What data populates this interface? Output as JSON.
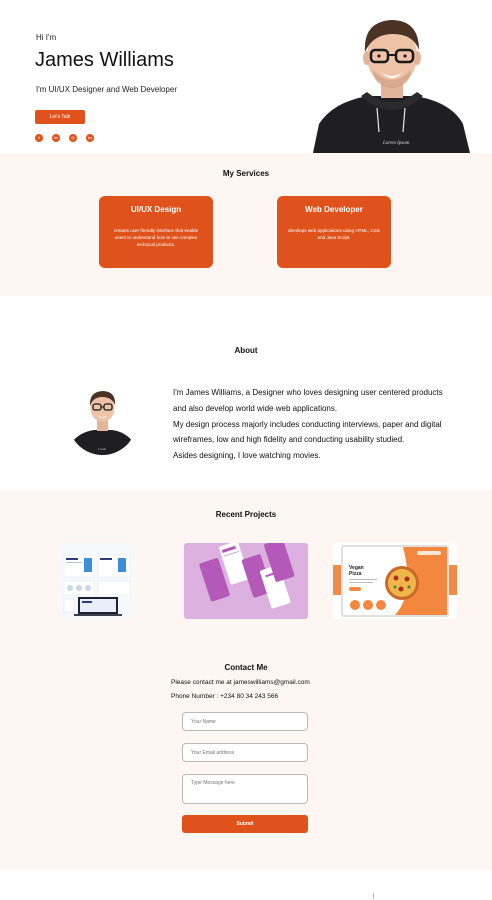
{
  "hero": {
    "greeting": "Hi I'm",
    "name": "James Williams",
    "role": "I'm UI/UX Designer and Web Developer",
    "cta_label": "Let's Talk",
    "socials": [
      {
        "icon": "twitter-icon",
        "glyph": "t"
      },
      {
        "icon": "linkedin-icon",
        "glyph": "in"
      },
      {
        "icon": "instagram-icon",
        "glyph": "◎"
      },
      {
        "icon": "linkedin-icon",
        "glyph": "in"
      }
    ]
  },
  "services": {
    "title": "My Services",
    "cards": [
      {
        "title": "UI/UX Design",
        "desc": "creates user friendly interface that enable users to understand how to use complex technical products."
      },
      {
        "title": "Web Developer",
        "desc": "develops web applications using HTML, CSS and Java Script."
      }
    ]
  },
  "about": {
    "title": "About",
    "lines": [
      "I'm James Williams, a Designer who loves designing user centered products",
      "and also develop world wide web applications.",
      "My design process majorly includes conducting interviews, paper and digital",
      "wireframes, low and high fidelity and conducting usability studied.",
      "Asides designing, I love watching movies."
    ]
  },
  "projects": {
    "title": "Recent Projects",
    "pizza": {
      "title_line1": "Vegan",
      "title_line2": "Pizza"
    }
  },
  "contact": {
    "title": "Contact Me",
    "email_line": "Please contact me at jameswilliams@gmail.com",
    "phone_line": "Phone Number : +234 80 34 243 566",
    "name_placeholder": "Your Name",
    "email_placeholder": "Your Email address",
    "message_placeholder": "Type Message here",
    "submit_label": "Submit"
  },
  "colors": {
    "accent": "#e0521b",
    "section_bg": "#fdf6f2"
  }
}
